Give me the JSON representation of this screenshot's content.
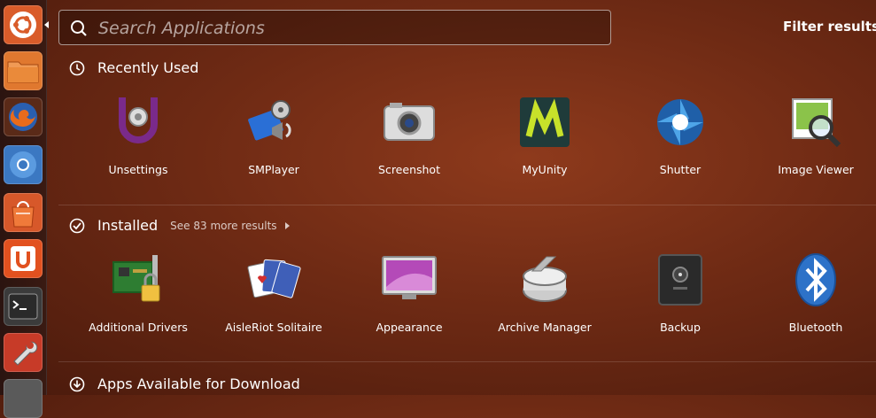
{
  "search": {
    "placeholder": "Search Applications",
    "value": ""
  },
  "filter_label": "Filter results",
  "launcher": {
    "items": [
      {
        "name": "dash-home-icon",
        "bg": "#d95c2a"
      },
      {
        "name": "files-icon",
        "bg": "#e0782f"
      },
      {
        "name": "firefox-icon",
        "bg": "#c2410f"
      },
      {
        "name": "chromium-icon",
        "bg": "#3b78c2"
      },
      {
        "name": "software-center-icon",
        "bg": "#d7582a"
      },
      {
        "name": "unsettings-icon",
        "bg": "#e2511f"
      },
      {
        "name": "terminal-icon",
        "bg": "#4a4a4a"
      },
      {
        "name": "system-settings-icon",
        "bg": "#c73b28"
      }
    ]
  },
  "recently_used": {
    "title": "Recently Used",
    "apps": [
      {
        "label": "Unsettings",
        "icon": "unsettings-icon"
      },
      {
        "label": "SMPlayer",
        "icon": "smplayer-icon"
      },
      {
        "label": "Screenshot",
        "icon": "screenshot-icon"
      },
      {
        "label": "MyUnity",
        "icon": "myunity-icon"
      },
      {
        "label": "Shutter",
        "icon": "shutter-icon"
      },
      {
        "label": "Image Viewer",
        "icon": "image-viewer-icon"
      }
    ]
  },
  "installed": {
    "title": "Installed",
    "more": "See 83 more results",
    "apps": [
      {
        "label": "Additional Drivers",
        "icon": "additional-drivers-icon"
      },
      {
        "label": "AisleRiot Solitaire",
        "icon": "aisleriot-icon"
      },
      {
        "label": "Appearance",
        "icon": "appearance-icon"
      },
      {
        "label": "Archive Manager",
        "icon": "archive-manager-icon"
      },
      {
        "label": "Backup",
        "icon": "backup-icon"
      },
      {
        "label": "Bluetooth",
        "icon": "bluetooth-icon"
      }
    ]
  },
  "download": {
    "title": "Apps Available for Download"
  }
}
